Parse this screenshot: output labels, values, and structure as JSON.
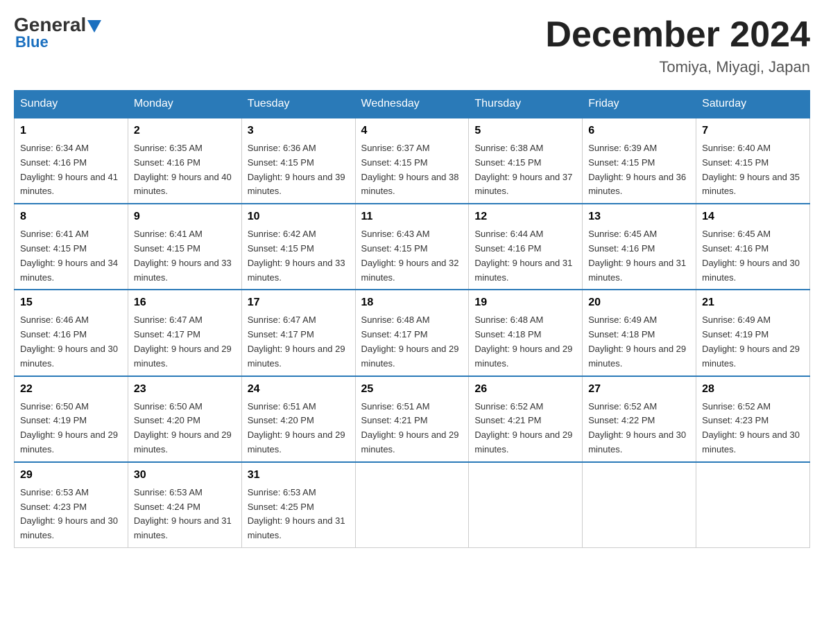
{
  "header": {
    "logo_general": "General",
    "logo_blue": "Blue",
    "month_title": "December 2024",
    "location": "Tomiya, Miyagi, Japan"
  },
  "weekdays": [
    "Sunday",
    "Monday",
    "Tuesday",
    "Wednesday",
    "Thursday",
    "Friday",
    "Saturday"
  ],
  "weeks": [
    [
      {
        "day": "1",
        "sunrise": "6:34 AM",
        "sunset": "4:16 PM",
        "daylight": "9 hours and 41 minutes."
      },
      {
        "day": "2",
        "sunrise": "6:35 AM",
        "sunset": "4:16 PM",
        "daylight": "9 hours and 40 minutes."
      },
      {
        "day": "3",
        "sunrise": "6:36 AM",
        "sunset": "4:15 PM",
        "daylight": "9 hours and 39 minutes."
      },
      {
        "day": "4",
        "sunrise": "6:37 AM",
        "sunset": "4:15 PM",
        "daylight": "9 hours and 38 minutes."
      },
      {
        "day": "5",
        "sunrise": "6:38 AM",
        "sunset": "4:15 PM",
        "daylight": "9 hours and 37 minutes."
      },
      {
        "day": "6",
        "sunrise": "6:39 AM",
        "sunset": "4:15 PM",
        "daylight": "9 hours and 36 minutes."
      },
      {
        "day": "7",
        "sunrise": "6:40 AM",
        "sunset": "4:15 PM",
        "daylight": "9 hours and 35 minutes."
      }
    ],
    [
      {
        "day": "8",
        "sunrise": "6:41 AM",
        "sunset": "4:15 PM",
        "daylight": "9 hours and 34 minutes."
      },
      {
        "day": "9",
        "sunrise": "6:41 AM",
        "sunset": "4:15 PM",
        "daylight": "9 hours and 33 minutes."
      },
      {
        "day": "10",
        "sunrise": "6:42 AM",
        "sunset": "4:15 PM",
        "daylight": "9 hours and 33 minutes."
      },
      {
        "day": "11",
        "sunrise": "6:43 AM",
        "sunset": "4:15 PM",
        "daylight": "9 hours and 32 minutes."
      },
      {
        "day": "12",
        "sunrise": "6:44 AM",
        "sunset": "4:16 PM",
        "daylight": "9 hours and 31 minutes."
      },
      {
        "day": "13",
        "sunrise": "6:45 AM",
        "sunset": "4:16 PM",
        "daylight": "9 hours and 31 minutes."
      },
      {
        "day": "14",
        "sunrise": "6:45 AM",
        "sunset": "4:16 PM",
        "daylight": "9 hours and 30 minutes."
      }
    ],
    [
      {
        "day": "15",
        "sunrise": "6:46 AM",
        "sunset": "4:16 PM",
        "daylight": "9 hours and 30 minutes."
      },
      {
        "day": "16",
        "sunrise": "6:47 AM",
        "sunset": "4:17 PM",
        "daylight": "9 hours and 29 minutes."
      },
      {
        "day": "17",
        "sunrise": "6:47 AM",
        "sunset": "4:17 PM",
        "daylight": "9 hours and 29 minutes."
      },
      {
        "day": "18",
        "sunrise": "6:48 AM",
        "sunset": "4:17 PM",
        "daylight": "9 hours and 29 minutes."
      },
      {
        "day": "19",
        "sunrise": "6:48 AM",
        "sunset": "4:18 PM",
        "daylight": "9 hours and 29 minutes."
      },
      {
        "day": "20",
        "sunrise": "6:49 AM",
        "sunset": "4:18 PM",
        "daylight": "9 hours and 29 minutes."
      },
      {
        "day": "21",
        "sunrise": "6:49 AM",
        "sunset": "4:19 PM",
        "daylight": "9 hours and 29 minutes."
      }
    ],
    [
      {
        "day": "22",
        "sunrise": "6:50 AM",
        "sunset": "4:19 PM",
        "daylight": "9 hours and 29 minutes."
      },
      {
        "day": "23",
        "sunrise": "6:50 AM",
        "sunset": "4:20 PM",
        "daylight": "9 hours and 29 minutes."
      },
      {
        "day": "24",
        "sunrise": "6:51 AM",
        "sunset": "4:20 PM",
        "daylight": "9 hours and 29 minutes."
      },
      {
        "day": "25",
        "sunrise": "6:51 AM",
        "sunset": "4:21 PM",
        "daylight": "9 hours and 29 minutes."
      },
      {
        "day": "26",
        "sunrise": "6:52 AM",
        "sunset": "4:21 PM",
        "daylight": "9 hours and 29 minutes."
      },
      {
        "day": "27",
        "sunrise": "6:52 AM",
        "sunset": "4:22 PM",
        "daylight": "9 hours and 30 minutes."
      },
      {
        "day": "28",
        "sunrise": "6:52 AM",
        "sunset": "4:23 PM",
        "daylight": "9 hours and 30 minutes."
      }
    ],
    [
      {
        "day": "29",
        "sunrise": "6:53 AM",
        "sunset": "4:23 PM",
        "daylight": "9 hours and 30 minutes."
      },
      {
        "day": "30",
        "sunrise": "6:53 AM",
        "sunset": "4:24 PM",
        "daylight": "9 hours and 31 minutes."
      },
      {
        "day": "31",
        "sunrise": "6:53 AM",
        "sunset": "4:25 PM",
        "daylight": "9 hours and 31 minutes."
      },
      null,
      null,
      null,
      null
    ]
  ]
}
